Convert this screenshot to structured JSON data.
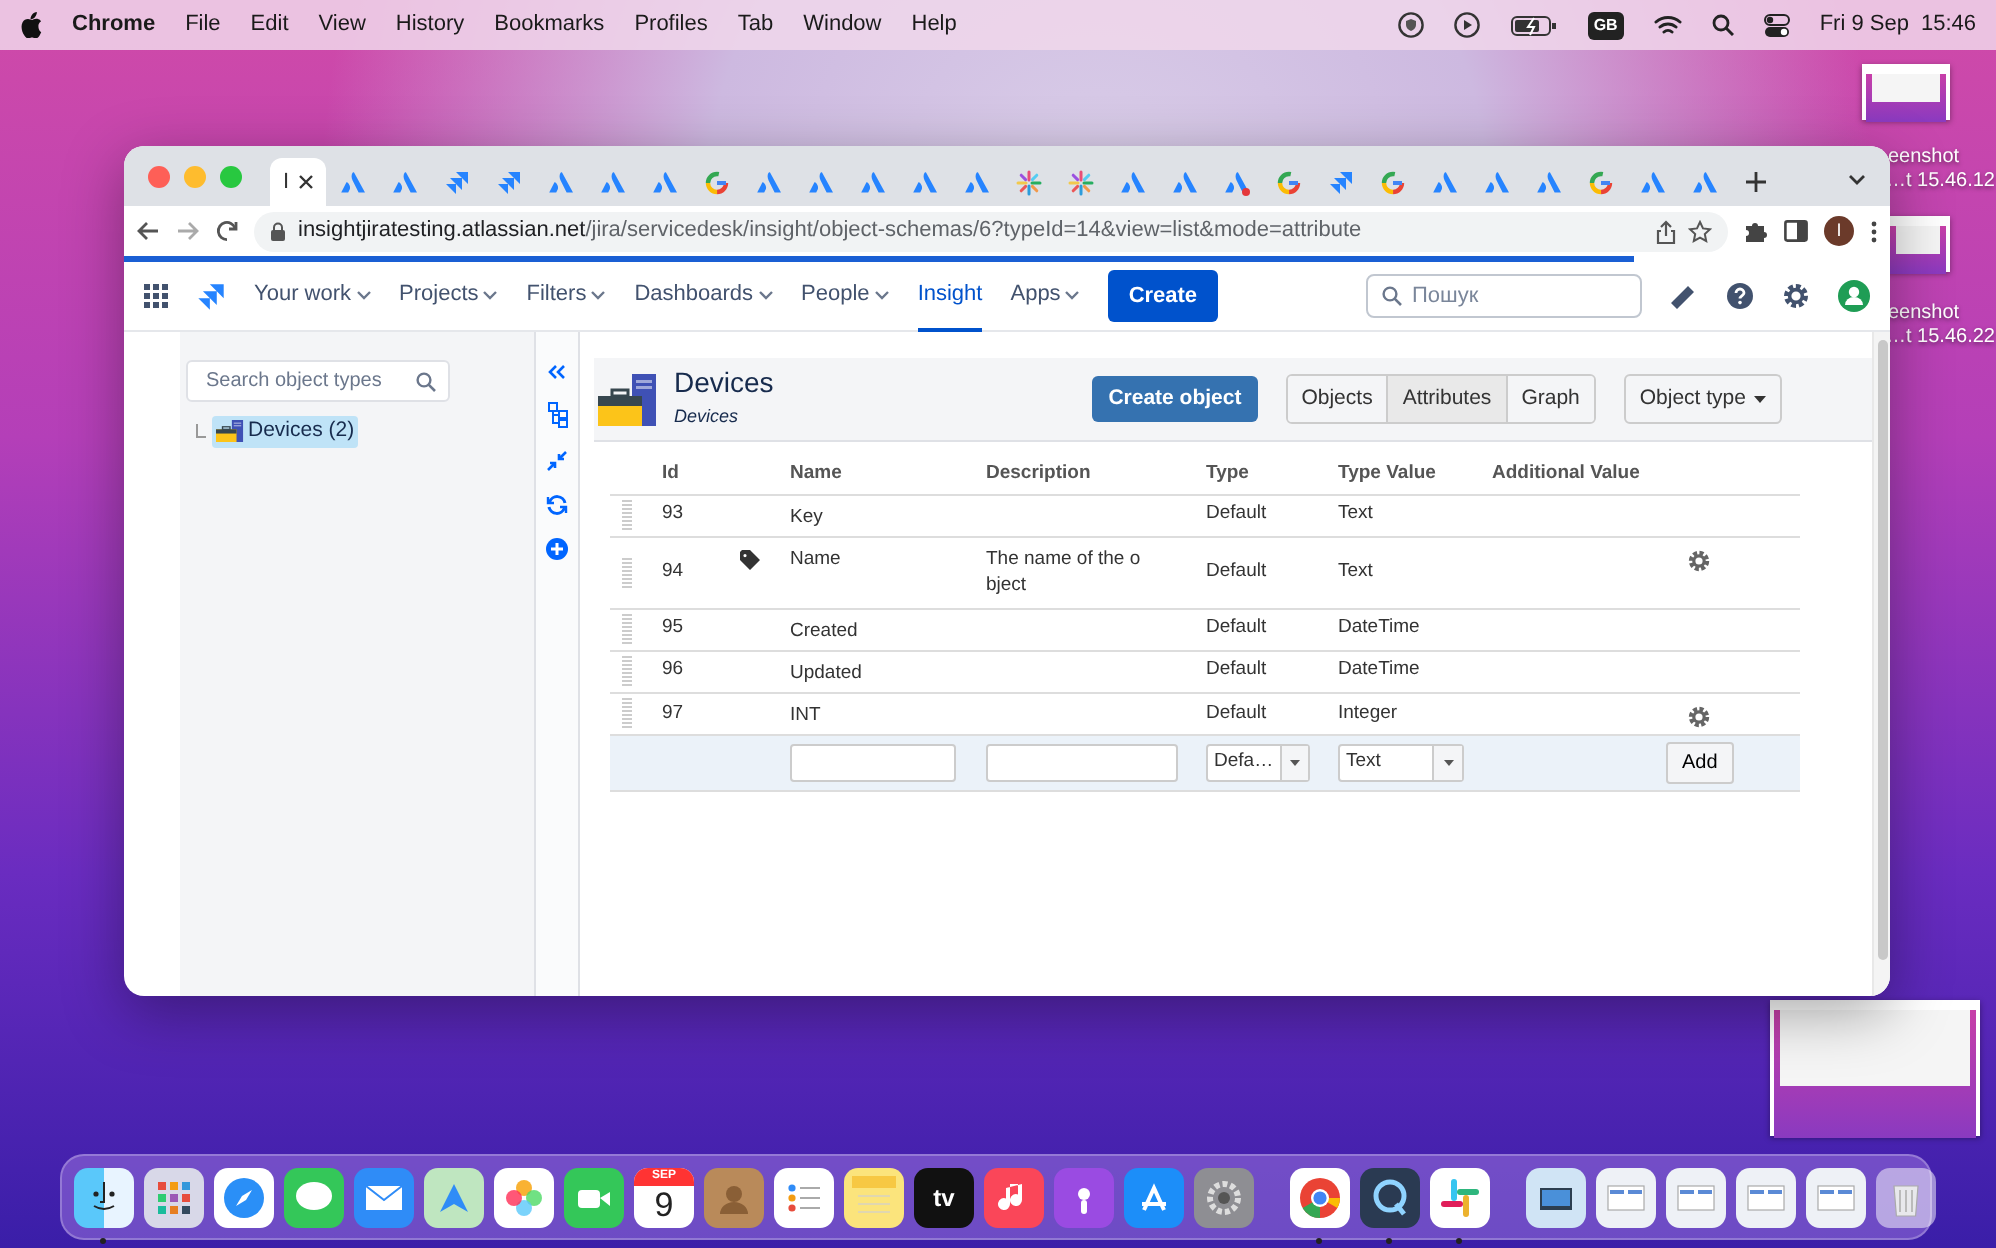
{
  "menu_bar": {
    "app": "Chrome",
    "items": [
      "File",
      "Edit",
      "View",
      "History",
      "Bookmarks",
      "Profiles",
      "Tab",
      "Window",
      "Help"
    ],
    "input_source": "GB",
    "date": "Fri 9 Sep",
    "time": "15:46"
  },
  "desktop_icons": [
    {
      "lines": [
        "eenshot",
        "…t 15.46.12"
      ]
    },
    {
      "lines": [
        "eenshot",
        "…t 15.46.22"
      ]
    }
  ],
  "browser": {
    "tabs": [
      {
        "kind": "text",
        "label": "I",
        "selected": true
      },
      {
        "kind": "atlassian",
        "selected": false
      },
      {
        "kind": "atlassian",
        "selected": false
      },
      {
        "kind": "jira",
        "selected": false
      },
      {
        "kind": "jira",
        "selected": false
      },
      {
        "kind": "atlassian",
        "selected": false
      },
      {
        "kind": "atlassian",
        "selected": false
      },
      {
        "kind": "atlassian",
        "selected": false
      },
      {
        "kind": "google",
        "selected": false
      },
      {
        "kind": "atlassian",
        "selected": false
      },
      {
        "kind": "atlassian",
        "selected": false
      },
      {
        "kind": "atlassian",
        "selected": false
      },
      {
        "kind": "atlassian",
        "selected": false
      },
      {
        "kind": "atlassian",
        "selected": false
      },
      {
        "kind": "spark",
        "selected": false
      },
      {
        "kind": "spark",
        "selected": false
      },
      {
        "kind": "atlassian",
        "selected": false
      },
      {
        "kind": "atlassian",
        "selected": false
      },
      {
        "kind": "atlassian-alert",
        "selected": false
      },
      {
        "kind": "google",
        "selected": false
      },
      {
        "kind": "jira",
        "selected": false
      },
      {
        "kind": "google",
        "selected": false
      },
      {
        "kind": "atlassian",
        "selected": false
      },
      {
        "kind": "atlassian",
        "selected": false
      },
      {
        "kind": "atlassian",
        "selected": false
      },
      {
        "kind": "google",
        "selected": false
      },
      {
        "kind": "atlassian",
        "selected": false
      },
      {
        "kind": "atlassian",
        "selected": false
      }
    ],
    "url_host": "insightjiratesting.atlassian.net",
    "url_path": "/jira/servicedesk/insight/object-schemas/6?typeId=14&view=list&mode=attribute",
    "loading": {
      "level": 0.855
    },
    "profile_initial": "I"
  },
  "jira_nav": {
    "items": [
      {
        "label": "Your work",
        "dropdown": true,
        "selected": false
      },
      {
        "label": "Projects",
        "dropdown": true,
        "selected": false
      },
      {
        "label": "Filters",
        "dropdown": true,
        "selected": false
      },
      {
        "label": "Dashboards",
        "dropdown": true,
        "selected": false
      },
      {
        "label": "People",
        "dropdown": true,
        "selected": false
      },
      {
        "label": "Insight",
        "dropdown": false,
        "selected": true
      },
      {
        "label": "Apps",
        "dropdown": true,
        "selected": false
      }
    ],
    "create": "Create",
    "search_placeholder": "Пошук"
  },
  "sidebar": {
    "search_placeholder": "Search object types",
    "tree": [
      {
        "label": "Devices (2)",
        "selected": true
      }
    ]
  },
  "object_type": {
    "title": "Devices",
    "subtitle": "Devices",
    "create_button": "Create object",
    "views": [
      {
        "label": "Objects",
        "selected": false
      },
      {
        "label": "Attributes",
        "selected": true
      },
      {
        "label": "Graph",
        "selected": false
      }
    ],
    "type_menu": "Object type"
  },
  "attributes_table": {
    "columns": [
      "Id",
      "Name",
      "Description",
      "Type",
      "Type Value",
      "Additional Value"
    ],
    "rows": [
      {
        "id": "93",
        "label_attribute": false,
        "name": "Key",
        "type": "Default",
        "type_value": "Text",
        "settings": false
      },
      {
        "id": "94",
        "label_attribute": true,
        "name": "Name",
        "description": "The name of the o bject",
        "type": "Default",
        "type_value": "Text",
        "settings": true
      },
      {
        "id": "95",
        "label_attribute": false,
        "name": "Created",
        "type": "Default",
        "type_value": "DateTime",
        "settings": false
      },
      {
        "id": "96",
        "label_attribute": false,
        "name": "Updated",
        "type": "Default",
        "type_value": "DateTime",
        "settings": false
      },
      {
        "id": "97",
        "label_attribute": false,
        "name": "INT",
        "type": "Default",
        "type_value": "Integer",
        "settings": true
      }
    ],
    "new_row": {
      "type": "Defa…",
      "type_value": "Text",
      "add_button": "Add"
    }
  },
  "dock": {
    "apps": [
      {
        "kind": "finder",
        "running": true
      },
      {
        "kind": "launchpad",
        "running": false
      },
      {
        "kind": "safari",
        "running": false
      },
      {
        "kind": "messages",
        "running": false
      },
      {
        "kind": "mail",
        "running": false
      },
      {
        "kind": "maps",
        "running": false
      },
      {
        "kind": "photos",
        "running": false
      },
      {
        "kind": "facetime",
        "running": false
      },
      {
        "kind": "calendar",
        "month": "SEP",
        "day": "9",
        "running": false
      },
      {
        "kind": "contacts",
        "running": false
      },
      {
        "kind": "reminders",
        "running": false
      },
      {
        "kind": "notes",
        "running": false
      },
      {
        "kind": "tv",
        "label": "tv",
        "running": false
      },
      {
        "kind": "music",
        "running": false
      },
      {
        "kind": "podcasts",
        "running": false
      },
      {
        "kind": "appstore",
        "running": false
      },
      {
        "kind": "settings",
        "running": false
      }
    ],
    "open_apps": [
      {
        "kind": "chrome",
        "running": true
      },
      {
        "kind": "quicktime",
        "running": true
      },
      {
        "kind": "slack",
        "running": true
      }
    ],
    "stack": [
      {
        "kind": "folder"
      },
      {
        "kind": "window"
      },
      {
        "kind": "window"
      },
      {
        "kind": "window"
      },
      {
        "kind": "window"
      },
      {
        "kind": "trash"
      }
    ]
  }
}
